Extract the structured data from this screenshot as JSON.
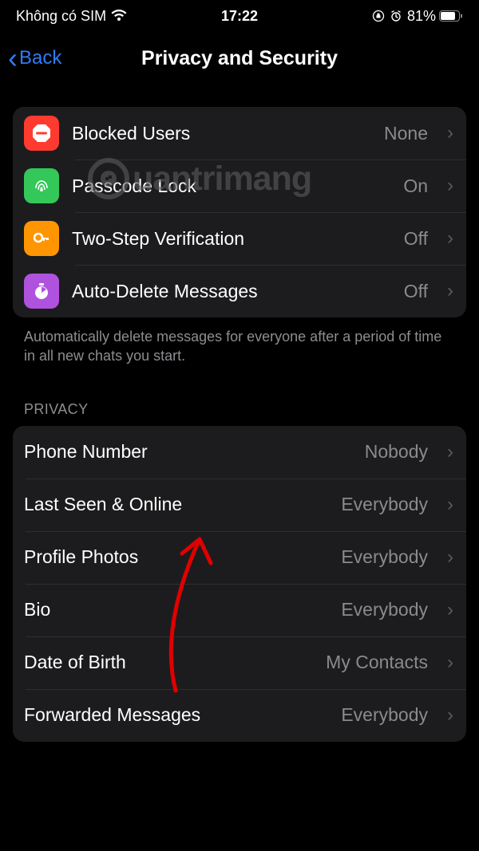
{
  "status": {
    "carrier": "Không có SIM",
    "time": "17:22",
    "battery_percent": "81%"
  },
  "nav": {
    "back_label": "Back",
    "title": "Privacy and Security"
  },
  "security_group": [
    {
      "icon": "block-icon",
      "icon_bg": "#ff3b30",
      "label": "Blocked Users",
      "value": "None"
    },
    {
      "icon": "fingerprint-icon",
      "icon_bg": "#34c759",
      "label": "Passcode Lock",
      "value": "On"
    },
    {
      "icon": "key-icon",
      "icon_bg": "#ff9500",
      "label": "Two-Step Verification",
      "value": "Off"
    },
    {
      "icon": "timer-icon",
      "icon_bg": "#af52de",
      "label": "Auto-Delete Messages",
      "value": "Off"
    }
  ],
  "security_footer": "Automatically delete messages for everyone after a period of time in all new chats you start.",
  "privacy_header": "PRIVACY",
  "privacy_group": [
    {
      "label": "Phone Number",
      "value": "Nobody"
    },
    {
      "label": "Last Seen & Online",
      "value": "Everybody"
    },
    {
      "label": "Profile Photos",
      "value": "Everybody"
    },
    {
      "label": "Bio",
      "value": "Everybody"
    },
    {
      "label": "Date of Birth",
      "value": "My Contacts"
    },
    {
      "label": "Forwarded Messages",
      "value": "Everybody"
    }
  ],
  "watermark": "uantrimang"
}
